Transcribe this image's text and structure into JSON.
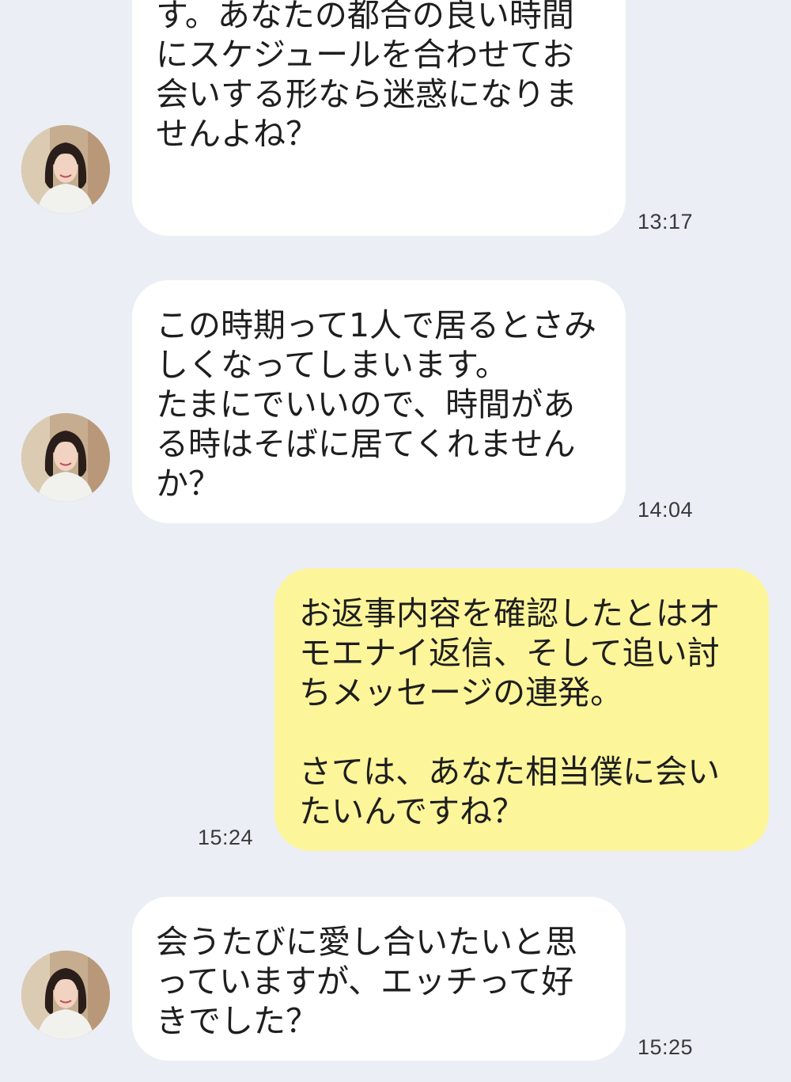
{
  "colors": {
    "background": "#ebeef5",
    "incoming_bubble": "#ffffff",
    "outgoing_bubble": "#fdf59a",
    "text": "#1e1e1e",
    "timestamp": "#3a3a3a"
  },
  "contact": {
    "avatar_icon": "profile-photo-woman"
  },
  "messages": [
    {
      "direction": "incoming",
      "text": "ったこともあって初対面はち\nょっと緊張してしまいそうで\nす。あなたの都合の良い時間\nにスケジュールを合わせてお\n会いする形なら迷惑になりま\nせんよね？",
      "time": "13:17"
    },
    {
      "direction": "incoming",
      "text": "この時期って1人で居るとさみ\nしくなってしまいます。\nたまにでいいので、時間があ\nる時はそばに居てくれません\nか？",
      "time": "14:04"
    },
    {
      "direction": "outgoing",
      "text": "お返事内容を確認したとはオ\nモエナイ返信、そして追い討\nちメッセージの連発。\n\nさては、あなた相当僕に会い\nたいんですね？",
      "time": "15:24"
    },
    {
      "direction": "incoming",
      "text": "会うたびに愛し合いたいと思\nっていますが、エッチって好\nきでした？",
      "time": "15:25"
    }
  ]
}
